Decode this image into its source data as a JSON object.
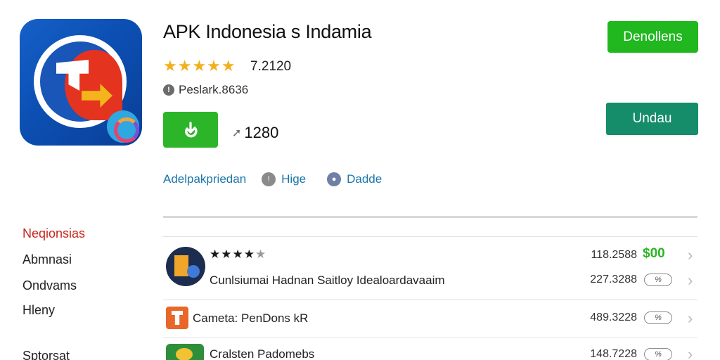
{
  "app": {
    "title": "APK Indonesia s Indamia",
    "stars": "★★★★★",
    "rating": "7.2120",
    "meta": "Peslark.8636",
    "size": "1280"
  },
  "buttons": {
    "download": "Denollens",
    "update": "Undau"
  },
  "chips": [
    {
      "label": "Adelpakpriedan",
      "icon": "none"
    },
    {
      "label": "Hige",
      "icon": "info-icon"
    },
    {
      "label": "Dadde",
      "icon": "person-icon"
    }
  ],
  "sidebar": {
    "items": [
      {
        "label": "Neqionsias",
        "active": true
      },
      {
        "label": "Abmnasi",
        "active": false
      },
      {
        "label": "Ondvams",
        "active": false
      },
      {
        "label": "Hleny",
        "active": false
      },
      {
        "label": "Sptorsat",
        "active": false
      }
    ]
  },
  "list": {
    "rows": [
      {
        "stars_filled": "★★★★",
        "stars_empty": "★",
        "title": "",
        "value": "118.2588",
        "price": "$00",
        "pill": ""
      },
      {
        "stars_filled": "",
        "stars_empty": "",
        "title": "Cunlsiumai Hadnan Saitloy Idealoardavaaim",
        "value": "227.3288",
        "price": "",
        "pill": "%"
      },
      {
        "stars_filled": "",
        "stars_empty": "",
        "title": "Cameta: PenDons kR",
        "value": "489.3228",
        "price": "",
        "pill": "%"
      },
      {
        "stars_filled": "",
        "stars_empty": "",
        "title": "Cralsten Padomebs",
        "value": "148.7228",
        "price": "",
        "pill": "%"
      }
    ]
  },
  "colors": {
    "accent_green": "#2db52a",
    "update_teal": "#158c6a",
    "link_blue": "#1976a8",
    "active_red": "#c5281c",
    "star_gold": "#f2b01e"
  }
}
